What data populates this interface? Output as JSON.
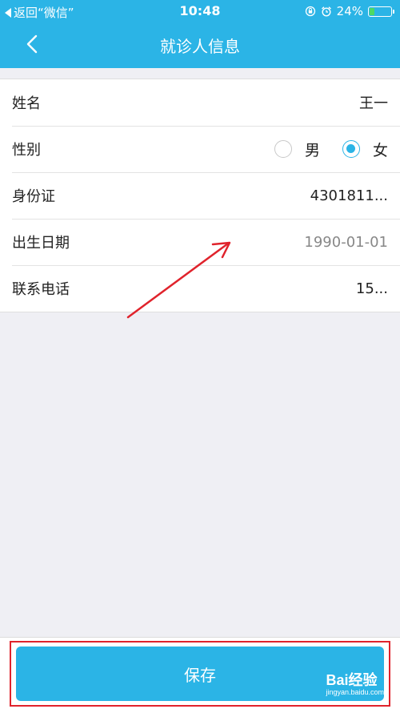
{
  "status_bar": {
    "back_text": "返回“微信”",
    "time": "10:48",
    "battery_text": "24%",
    "battery_level": 0.24
  },
  "nav": {
    "title": "就诊人信息"
  },
  "form": {
    "name": {
      "label": "姓名",
      "value": "王一"
    },
    "gender": {
      "label": "性别",
      "options": [
        {
          "label": "男",
          "selected": false
        },
        {
          "label": "女",
          "selected": true
        }
      ]
    },
    "id_card": {
      "label": "身份证",
      "value": "4301811..."
    },
    "birth_date": {
      "label": "出生日期",
      "value": "1990-01-01"
    },
    "phone": {
      "label": "联系电话",
      "value": "15..."
    }
  },
  "save_button": {
    "label": "保存"
  },
  "watermark": {
    "brand": "Bai经验",
    "url": "jingyan.baidu.com"
  },
  "colors": {
    "accent": "#2bb4e6",
    "annotation": "#e0232c",
    "battery_fill": "#4cd964",
    "background": "#efeff4"
  }
}
